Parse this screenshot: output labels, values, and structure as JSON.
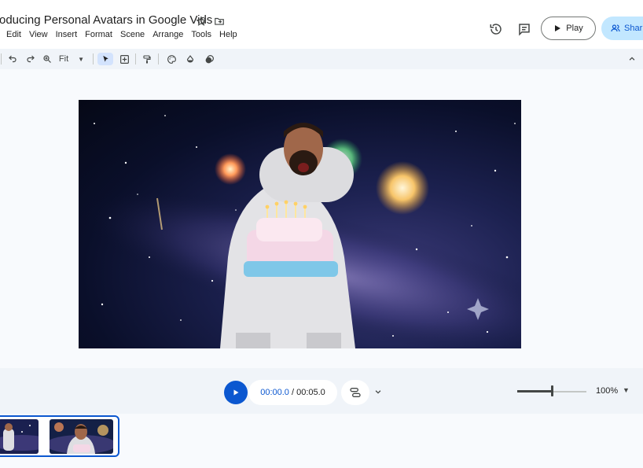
{
  "header": {
    "title": "oducing Personal Avatars in Google Vids",
    "menu": [
      "Edit",
      "View",
      "Insert",
      "Format",
      "Scene",
      "Arrange",
      "Tools",
      "Help"
    ],
    "play_label": "Play",
    "share_label": "Shar"
  },
  "toolbar": {
    "zoom_label": "Fit"
  },
  "playback": {
    "current_time": "00:00.0",
    "separator": " / ",
    "total_time": "00:05.0",
    "zoom_percent": "100%",
    "zoom_level_fraction": 0.5
  },
  "icons": {
    "star": "star-icon",
    "move_to_folder": "folder-move-icon",
    "history": "history-icon",
    "comments": "comment-icon",
    "undo": "undo-icon",
    "redo": "redo-icon",
    "zoom": "zoom-icon",
    "select": "cursor-icon",
    "add_box": "add-box-icon",
    "paint_format": "paint-format-icon",
    "palette": "palette-icon",
    "fill": "fill-icon",
    "effects": "effects-icon",
    "collapse": "chevron-up-icon"
  },
  "colors": {
    "accent": "#0b57d0",
    "share_bg": "#c2e7ff",
    "toolbar_bg": "#f0f4f9"
  }
}
